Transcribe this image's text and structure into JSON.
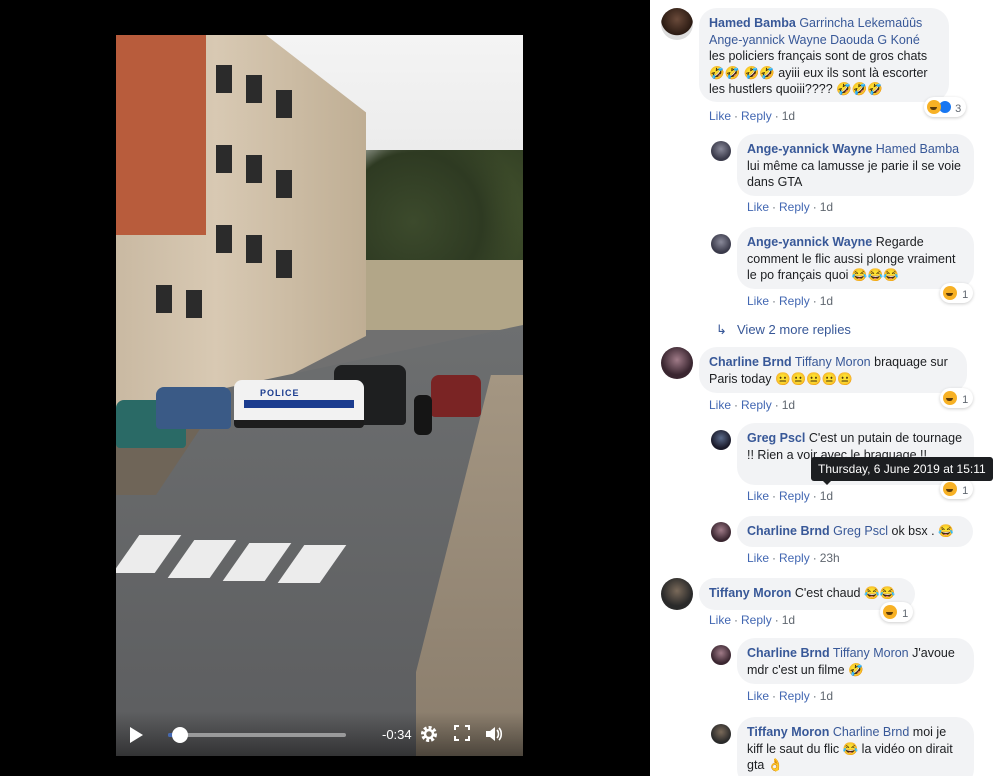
{
  "video": {
    "time_remaining": "-0:34",
    "progress": 0.07,
    "police_label": "POLICE"
  },
  "comments": [
    {
      "author": "Hamed Bamba",
      "tags": "Garrincha Lekemaûûs Ange-yannick Wayne Daouda G Koné",
      "text": " les policiers français sont de gros chats 🤣🤣 🤣🤣 ayiii eux ils sont là escorter les hustlers quoiii???? 🤣🤣🤣",
      "like": "Like",
      "reply": "Reply",
      "time": "1d",
      "reactions": "3"
    },
    {
      "author": "Ange-yannick Wayne",
      "tags": "Hamed Bamba",
      "text": " lui même ca lamusse je parie il se voie dans GTA",
      "like": "Like",
      "reply": "Reply",
      "time": "1d"
    },
    {
      "author": "Ange-yannick Wayne",
      "tags": "",
      "text": " Regarde comment le flic aussi plonge vraiment le po français quoi 😂😂😂",
      "like": "Like",
      "reply": "Reply",
      "time": "1d",
      "reactions": "1"
    },
    {
      "author": "Charline Brnd",
      "tags": "Tiffany Moron",
      "text": " braquage sur Paris today 😐😐😐😐😐",
      "like": "Like",
      "reply": "Reply",
      "time": "1d",
      "reactions": "1"
    },
    {
      "author": "Greg Pscl",
      "tags": "",
      "text": " C'est un putain de tournage !! Rien a voir avec le braquage !!",
      "like": "Like",
      "reply": "Reply",
      "time": "1d",
      "reactions": "1"
    },
    {
      "author": "Charline Brnd",
      "tags": "Greg Pscl",
      "text": " ok bsx . 😂",
      "like": "Like",
      "reply": "Reply",
      "time": "23h"
    },
    {
      "author": "Tiffany Moron",
      "tags": "",
      "text": " C'est chaud 😂😂",
      "like": "Like",
      "reply": "Reply",
      "time": "1d",
      "reactions": "1"
    },
    {
      "author": "Charline Brnd",
      "tags": "Tiffany Moron",
      "text": " J'avoue mdr c'est un filme 🤣",
      "like": "Like",
      "reply": "Reply",
      "time": "1d"
    },
    {
      "author": "Tiffany Moron",
      "tags": "Charline Brnd",
      "text": " moi je kiff le saut du flic 😂 la vidéo on dirait gta 👌",
      "like": "Like",
      "reply": "Reply",
      "time": "1d"
    }
  ],
  "view_more": "View 2 more replies",
  "tooltip": "Thursday, 6 June 2019 at 15:11",
  "colors": {
    "link": "#385898",
    "bubble": "#f2f3f5",
    "seek": "#4267b2"
  }
}
